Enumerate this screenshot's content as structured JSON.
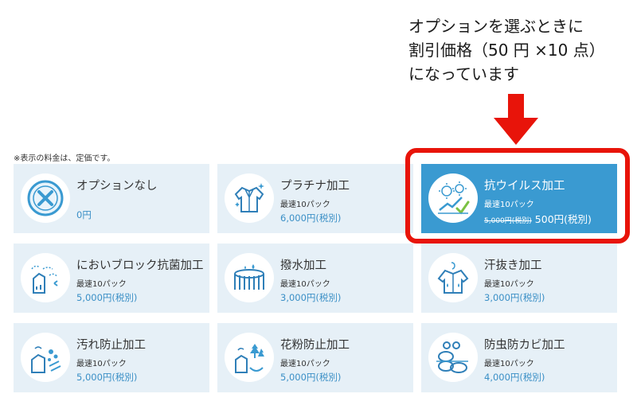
{
  "callout": {
    "lines": [
      "オプションを選ぶときに",
      "割引価格（50 円 ×10 点）",
      "になっています"
    ]
  },
  "note": "※表示の料金は、定価です。",
  "colors": {
    "accent": "#3a9ad1",
    "card_bg": "#e6f0f7",
    "price_text": "#3a8fc6",
    "highlight": "#e8140a"
  },
  "options": [
    {
      "title": "オプションなし",
      "price": "0円",
      "icon": "x-mark-icon"
    },
    {
      "title": "プラチナ加工",
      "sub": "最速10パック",
      "price": "6,000円(税別)",
      "icon": "jacket-sparkle-icon"
    },
    {
      "title": "抗ウイルス加工",
      "sub": "最速10パック",
      "old_price": "5,000円(税別)",
      "price": "500円(税別)",
      "icon": "virus-check-icon",
      "selected": true
    },
    {
      "title": "においブロック抗菌加工",
      "sub": "最速10パック",
      "price": "5,000円(税別)",
      "icon": "odor-block-icon"
    },
    {
      "title": "撥水加工",
      "sub": "最速10パック",
      "price": "3,000円(税別)",
      "icon": "water-repel-icon"
    },
    {
      "title": "汗抜き加工",
      "sub": "最速10パック",
      "price": "3,000円(税別)",
      "icon": "sweat-shirt-icon"
    },
    {
      "title": "汚れ防止加工",
      "sub": "最速10パック",
      "price": "5,000円(税別)",
      "icon": "stain-guard-icon"
    },
    {
      "title": "花粉防止加工",
      "sub": "最速10パック",
      "price": "5,000円(税別)",
      "icon": "pollen-guard-icon"
    },
    {
      "title": "防虫防カビ加工",
      "sub": "最速10パック",
      "price": "4,000円(税別)",
      "icon": "insect-mold-icon"
    }
  ]
}
